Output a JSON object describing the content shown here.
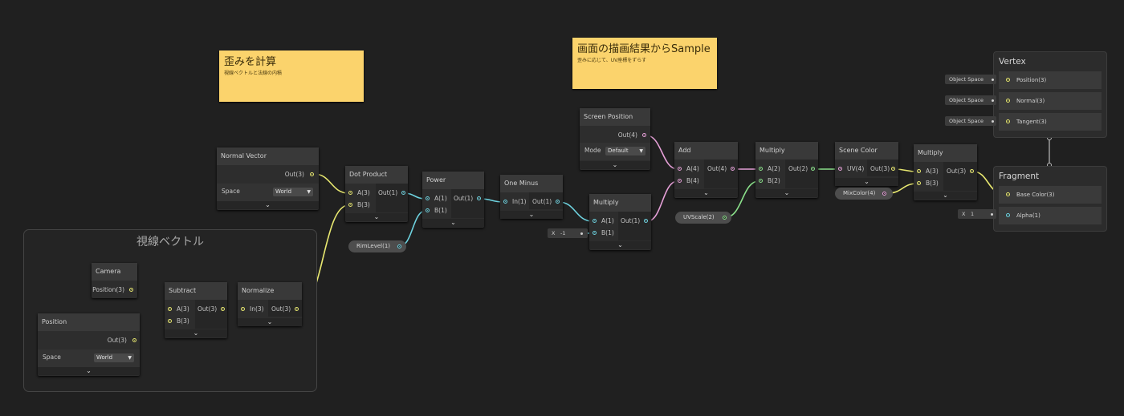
{
  "colors": {
    "background": "#202020",
    "sticky": "#fbd36c",
    "float_wire": "#e8e870",
    "vec2_wire": "#8ae08a",
    "vec4_wire": "#e6a0d8",
    "float1_wire": "#6ed3e0"
  },
  "group": {
    "title": "視線ベクトル"
  },
  "sticky_notes": [
    {
      "title": "歪みを計算",
      "subtitle": "視線ベクトルと法線の内積"
    },
    {
      "title": "画面の描画結果からSample",
      "subtitle": "歪みに応じて、UV座標をずらす"
    }
  ],
  "nodes": {
    "normal_vector": {
      "title": "Normal Vector",
      "out": "Out(3)",
      "setting_label": "Space",
      "setting_value": "World"
    },
    "camera": {
      "title": "Camera",
      "out": "Position(3)"
    },
    "position": {
      "title": "Position",
      "out": "Out(3)",
      "setting_label": "Space",
      "setting_value": "World"
    },
    "subtract": {
      "title": "Subtract",
      "in_a": "A(3)",
      "in_b": "B(3)",
      "out": "Out(3)"
    },
    "normalize": {
      "title": "Normalize",
      "in_a": "In(3)",
      "out": "Out(3)"
    },
    "dot_product": {
      "title": "Dot Product",
      "in_a": "A(3)",
      "in_b": "B(3)",
      "out": "Out(1)"
    },
    "power": {
      "title": "Power",
      "in_a": "A(1)",
      "in_b": "B(1)",
      "out": "Out(1)"
    },
    "one_minus": {
      "title": "One Minus",
      "in_a": "In(1)",
      "out": "Out(1)"
    },
    "multiply1": {
      "title": "Multiply",
      "in_a": "A(1)",
      "in_b": "B(1)",
      "out": "Out(1)",
      "b_axis": "X",
      "b_value": "-1"
    },
    "screen_position": {
      "title": "Screen Position",
      "out": "Out(4)",
      "setting_label": "Mode",
      "setting_value": "Default"
    },
    "add": {
      "title": "Add",
      "in_a": "A(4)",
      "in_b": "B(4)",
      "out": "Out(4)"
    },
    "multiply2": {
      "title": "Multiply",
      "in_a": "A(2)",
      "in_b": "B(2)",
      "out": "Out(2)"
    },
    "scene_color": {
      "title": "Scene Color",
      "in_a": "UV(4)",
      "out": "Out(3)"
    },
    "multiply3": {
      "title": "Multiply",
      "in_a": "A(3)",
      "in_b": "B(3)",
      "out": "Out(3)"
    }
  },
  "properties": {
    "rim_level": "RimLevel(1)",
    "uv_scale": "UVScale(2)",
    "mix_color": "MixColor(4)"
  },
  "vertex": {
    "title": "Vertex",
    "slots": [
      {
        "source": "Object Space",
        "label": "Position(3)"
      },
      {
        "source": "Object Space",
        "label": "Normal(3)"
      },
      {
        "source": "Object Space",
        "label": "Tangent(3)"
      }
    ]
  },
  "fragment": {
    "title": "Fragment",
    "base_color": "Base Color(3)",
    "alpha": "Alpha(1)",
    "alpha_axis": "X",
    "alpha_value": "1"
  }
}
